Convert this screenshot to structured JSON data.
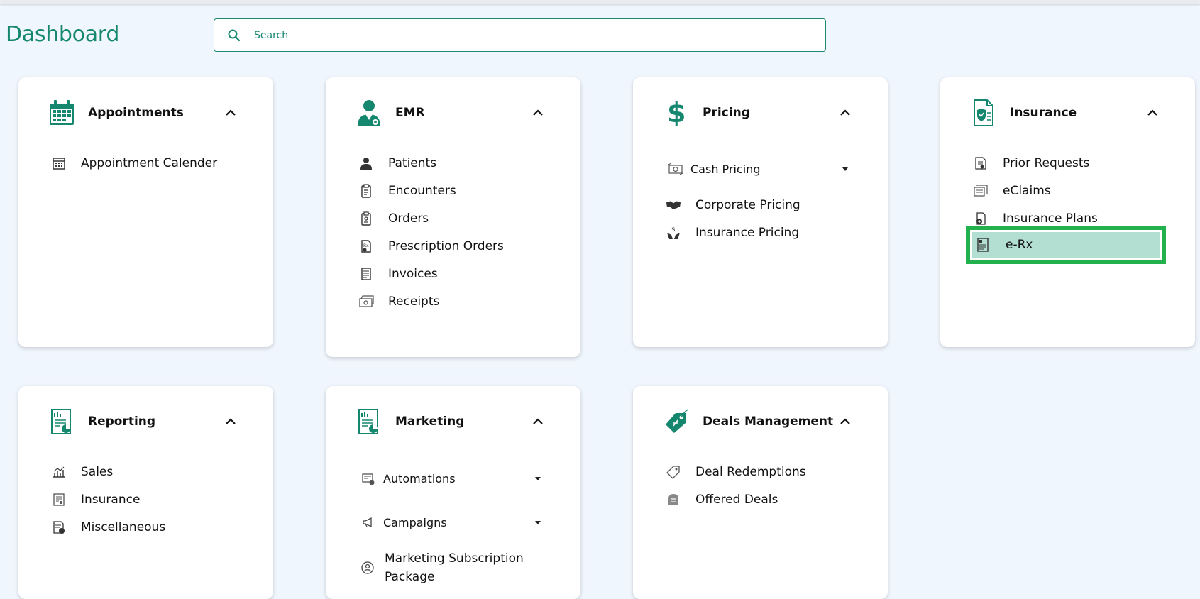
{
  "page": {
    "title": "Dashboard"
  },
  "search": {
    "placeholder": "Search"
  },
  "colors": {
    "brand": "#16876f",
    "highlight_border": "#22b14c",
    "highlight_fill": "#b2dfd2",
    "background": "#f0f6fd"
  },
  "cards": {
    "appointments": {
      "title": "Appointments",
      "icon": "calendar-icon",
      "items": [
        {
          "label": "Appointment Calender",
          "icon": "calendar-grid-icon"
        }
      ]
    },
    "emr": {
      "title": "EMR",
      "icon": "doctor-icon",
      "items": [
        {
          "label": "Patients",
          "icon": "patient-icon"
        },
        {
          "label": "Encounters",
          "icon": "clipboard-list-icon"
        },
        {
          "label": "Orders",
          "icon": "clipboard-order-icon"
        },
        {
          "label": "Prescription Orders",
          "icon": "prescription-icon"
        },
        {
          "label": "Invoices",
          "icon": "invoice-icon"
        },
        {
          "label": "Receipts",
          "icon": "receipt-icon"
        }
      ]
    },
    "pricing": {
      "title": "Pricing",
      "icon": "dollar-icon",
      "dropdown": {
        "label": "Cash Pricing",
        "icon": "cash-icon"
      },
      "items": [
        {
          "label": "Corporate Pricing",
          "icon": "handshake-icon"
        },
        {
          "label": "Insurance Pricing",
          "icon": "money-hands-icon"
        }
      ]
    },
    "insurance": {
      "title": "Insurance",
      "icon": "insurance-document-icon",
      "items": [
        {
          "label": "Prior Requests",
          "icon": "request-document-icon"
        },
        {
          "label": "eClaims",
          "icon": "claims-icon"
        },
        {
          "label": "Insurance Plans",
          "icon": "plans-icon"
        },
        {
          "label": "e-Rx",
          "icon": "erx-icon",
          "selected": true
        }
      ]
    },
    "reporting": {
      "title": "Reporting",
      "icon": "report-icon",
      "items": [
        {
          "label": "Sales",
          "icon": "sales-chart-icon"
        },
        {
          "label": "Insurance",
          "icon": "insurance-report-icon"
        },
        {
          "label": "Miscellaneous",
          "icon": "misc-report-icon"
        }
      ]
    },
    "marketing": {
      "title": "Marketing",
      "icon": "marketing-report-icon",
      "dropdowns": [
        {
          "label": "Automations",
          "icon": "automation-icon"
        },
        {
          "label": "Campaigns",
          "icon": "megaphone-icon"
        }
      ],
      "items": [
        {
          "label": "Marketing Subscription Package",
          "icon": "subscription-icon"
        }
      ]
    },
    "deals": {
      "title": "Deals Management",
      "icon": "deal-tag-icon",
      "items": [
        {
          "label": "Deal Redemptions",
          "icon": "tag-icon"
        },
        {
          "label": "Offered Deals",
          "icon": "offered-deals-icon"
        }
      ]
    }
  }
}
